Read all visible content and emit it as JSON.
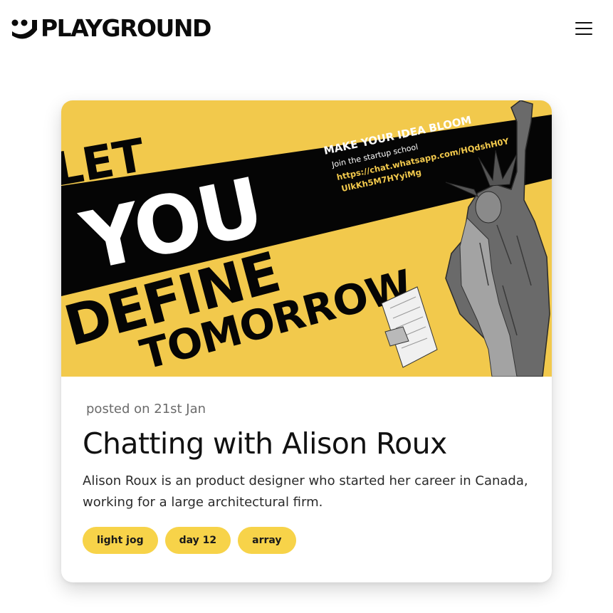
{
  "header": {
    "logo_text": "PLAYGROUND",
    "logo_icon": "smiley-mark-icon",
    "menu_icon": "hamburger-menu-icon"
  },
  "post": {
    "posted": "posted on 21st Jan",
    "title": "Chatting with Alison Roux",
    "description": "Alison Roux is an product designer who started her career in Canada, working for a large architectural firm.",
    "tags": [
      "light jog",
      "day 12",
      "array"
    ],
    "banner": {
      "word_let": "LET",
      "word_you": "YOU",
      "word_define": "DEFINE",
      "word_tomorrow": "TOMORROW",
      "headline": "MAKE YOUR IDEA BLOOM",
      "subline": "Join the startup school",
      "link_line1": "https://chat.whatsapp.com/HQdshH0Y",
      "link_line2": "UlkKh5M7HYyiMg",
      "background_color": "#f2c94c",
      "band_color": "#050505",
      "link_color": "#f2c94c"
    }
  },
  "colors": {
    "accent": "#f7d349",
    "text": "#111111",
    "muted": "#6b6b6b"
  }
}
